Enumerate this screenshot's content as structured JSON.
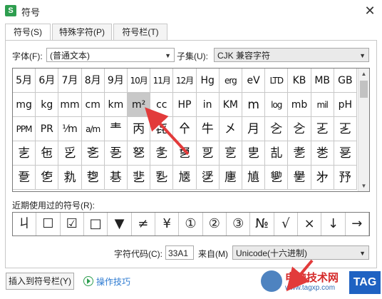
{
  "window": {
    "title": "符号",
    "app_icon": "S"
  },
  "tabs": [
    {
      "label": "符号(S)"
    },
    {
      "label": "特殊字符(P)"
    },
    {
      "label": "符号栏(T)"
    }
  ],
  "font": {
    "label": "字体(F):",
    "value": "(普通文本)"
  },
  "subset": {
    "label": "子集(U):",
    "value": "CJK 兼容字符"
  },
  "symbols": [
    [
      "5月",
      "6月",
      "7月",
      "8月",
      "9月",
      "10月",
      "11月",
      "12月",
      "Hg",
      "erg",
      "eV",
      "LTD",
      "KB",
      "MB",
      "GB"
    ],
    [
      "mg",
      "kg",
      "mm",
      "cm",
      "km",
      "m²",
      "cc",
      "HP",
      "in",
      "KM",
      "m",
      "log",
      "mb",
      "mil",
      "pH"
    ],
    [
      "PPM",
      "PR",
      "⅟m",
      "a/m",
      "龶",
      "丙",
      "㐂",
      "㐃",
      "牛",
      "㐅",
      "月",
      "㐈",
      "㐈",
      "㐉",
      "㐉"
    ],
    [
      "㐊",
      "㐌",
      "㐍",
      "㐎",
      "㐏",
      "㐐",
      "㐑",
      "㐒",
      "㐓",
      "㐔",
      "㐕",
      "㐖",
      "㐗",
      "㐘",
      "㐙"
    ],
    [
      "㐚",
      "㐛",
      "㐜",
      "㐝",
      "㐞",
      "㐟",
      "㐠",
      "㐡",
      "㐢",
      "㐣",
      "㐤",
      "㐥",
      "㐦",
      "㐧",
      "㐨"
    ]
  ],
  "recent": {
    "label": "近期使用过的符号(R):",
    "items": [
      "ㄐ",
      "☐",
      "☑",
      "□",
      "▼",
      "≠",
      "¥",
      "①",
      "②",
      "③",
      "№",
      "√",
      "×",
      "↓",
      "→"
    ]
  },
  "char_code": {
    "label": "字符代码(C):",
    "value": "33A1"
  },
  "from": {
    "label": "来自(M)",
    "value": "Unicode(十六进制)"
  },
  "insert_button": "插入到符号栏(Y)",
  "help_link": "操作技巧",
  "watermark": {
    "title": "电脑技术网",
    "url": "www.tagxp.com",
    "tag": "TAG"
  },
  "colors": {
    "arrow": "#e23b3b",
    "help_link": "#2e7bd1",
    "selected_cell": "#c8c8c8"
  }
}
